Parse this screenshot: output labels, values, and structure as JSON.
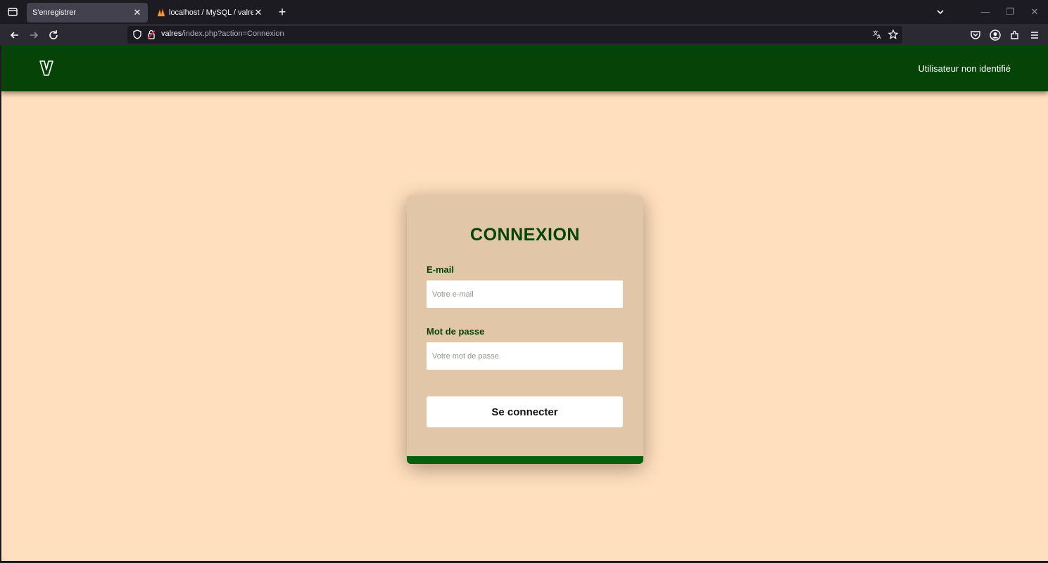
{
  "browser": {
    "tabs": [
      {
        "label": "S'enregistrer",
        "active": true
      },
      {
        "label": "localhost / MySQL / valres / uti",
        "active": false
      }
    ],
    "url": {
      "host": "valres",
      "path": "/index.php?action=Connexion"
    }
  },
  "site": {
    "logo_letter": "V",
    "user_status": "Utilisateur non identifié"
  },
  "login": {
    "title": "CONNEXION",
    "email_label": "E-mail",
    "email_placeholder": "Votre e-mail",
    "password_label": "Mot de passe",
    "password_placeholder": "Votre mot de passe",
    "submit_label": "Se connecter"
  },
  "colors": {
    "header_green": "#064307",
    "page_bg": "#ffdfbd",
    "card_bg": "#e2c6a8",
    "accent_green": "#0a5e0d"
  }
}
